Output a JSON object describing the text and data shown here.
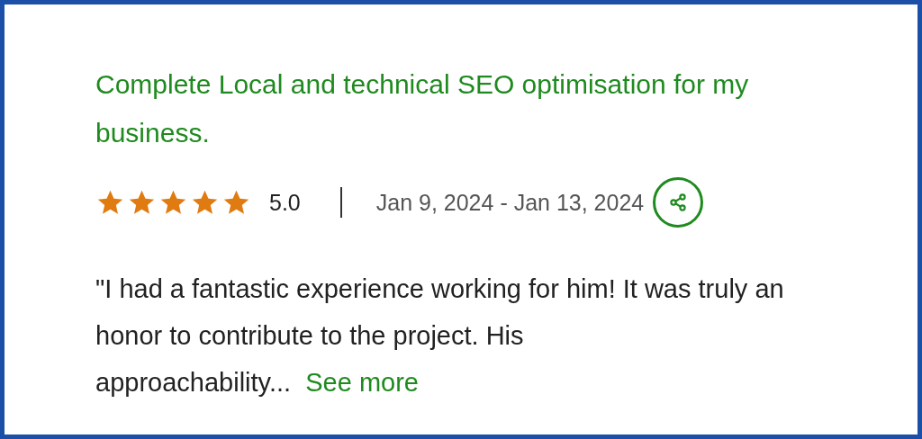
{
  "review": {
    "title": "Complete Local and technical SEO optimisation for my business.",
    "stars": 5,
    "rating": "5.0",
    "dates": "Jan 9, 2024 - Jan 13, 2024",
    "text": "\"I had a fantastic experience working for him! It was truly an honor to contribute to the project. His approachability...",
    "see_more": "See more"
  }
}
